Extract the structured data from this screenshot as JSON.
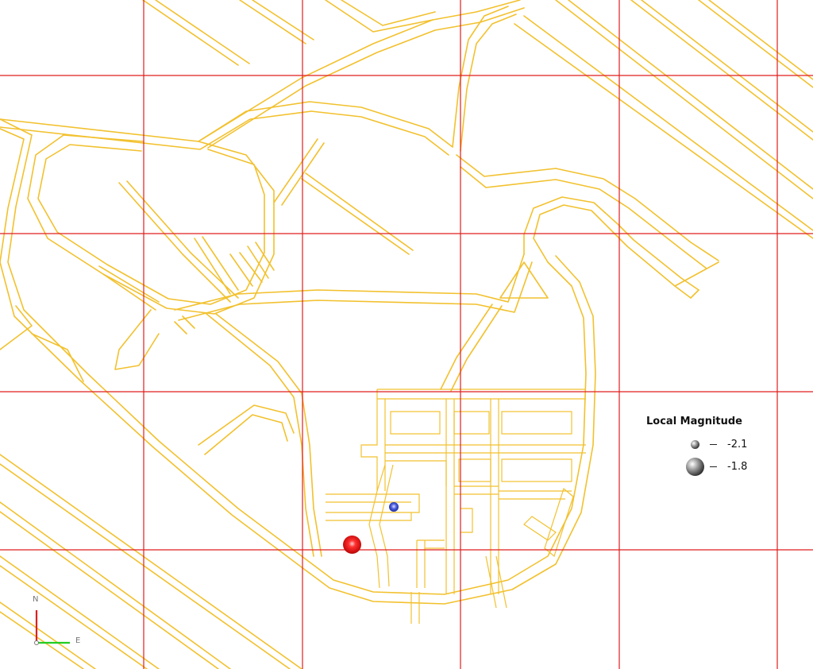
{
  "map": {
    "background_color": "#ffffff",
    "road_color": "#f2c12e",
    "grid_color": "#e11d1d"
  },
  "legend": {
    "title": "Local Magnitude",
    "entries": [
      {
        "value": "-2.1",
        "symbol": "sphere-small-icon"
      },
      {
        "value": "-1.8",
        "symbol": "sphere-large-icon"
      }
    ]
  },
  "events": [
    {
      "name": "event-red",
      "color": "#e02020",
      "magnitude": -1.8
    },
    {
      "name": "event-blue",
      "color": "#3344cc",
      "magnitude": -2.1
    }
  ],
  "orientation": {
    "north_label": "N",
    "east_label": "E",
    "north_color": "#e01e1e",
    "east_color": "#22cc22"
  }
}
